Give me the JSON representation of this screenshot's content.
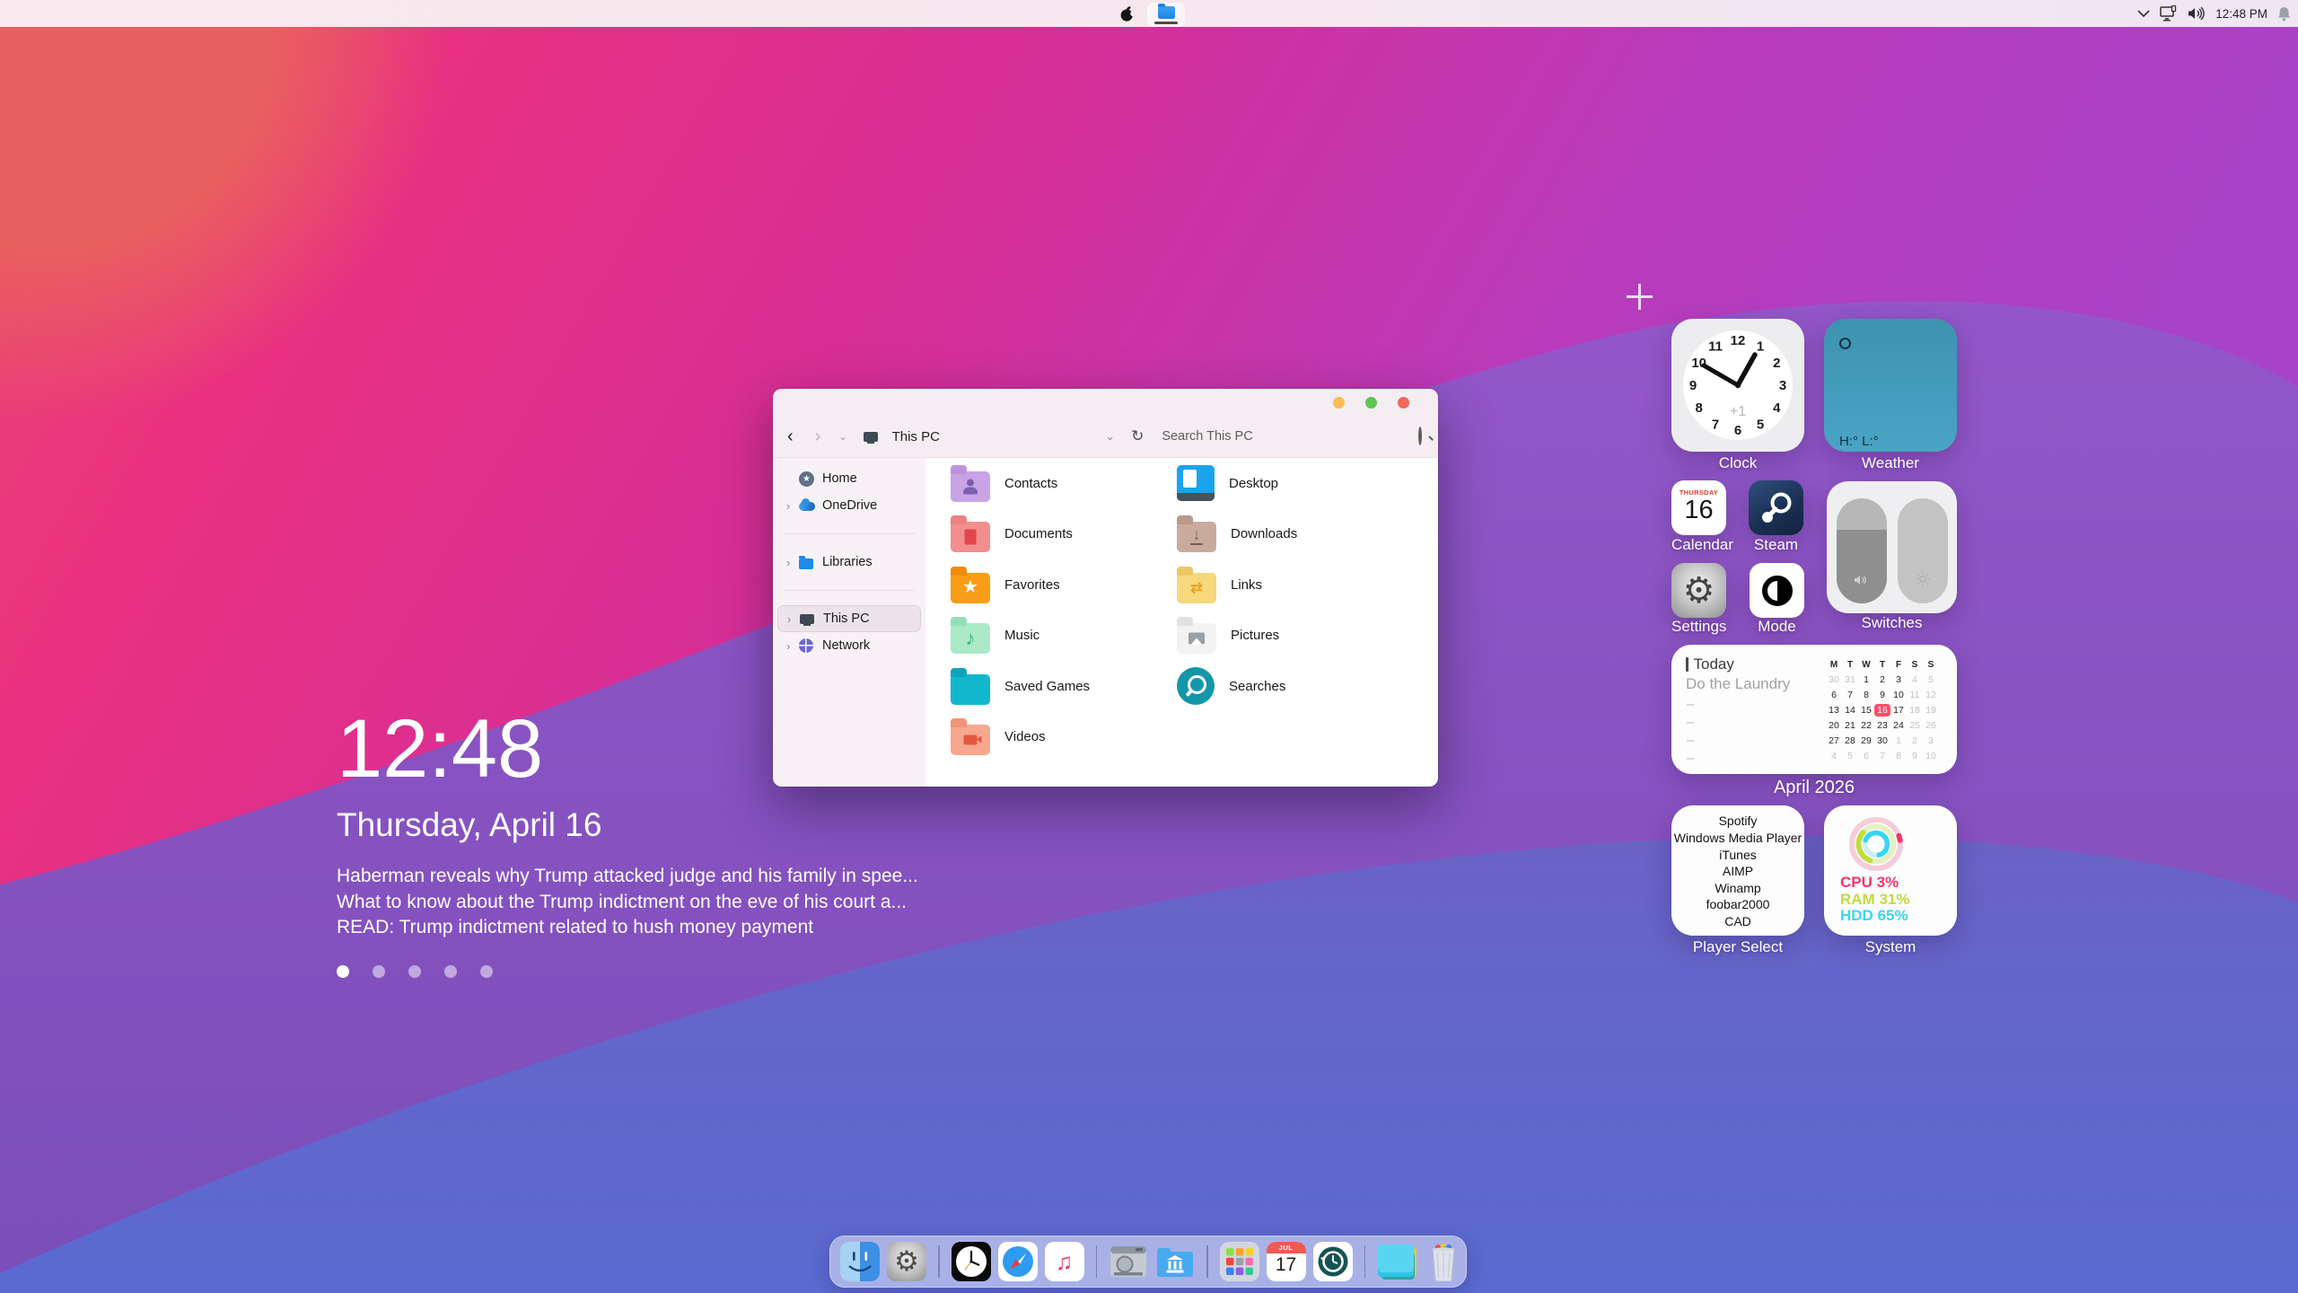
{
  "menu_bar": {
    "time": "12:48 PM",
    "taskbar_app": "file-explorer",
    "tray_icons": [
      "chevron-down-icon",
      "display-network-icon",
      "speaker-icon",
      "bell-icon"
    ]
  },
  "lockscreen": {
    "time": "12:48",
    "date": "Thursday, April 16",
    "headlines": [
      "Haberman reveals why Trump attacked judge and his family in spee...",
      "What to know about the Trump indictment on the eve of his court a...",
      "READ: Trump indictment related to hush money payment"
    ],
    "dots": 5
  },
  "window": {
    "title": "This PC",
    "search_placeholder": "Search This PC",
    "sidebar": [
      {
        "label": "Home",
        "icon": "home",
        "chevron": false
      },
      {
        "label": "OneDrive",
        "icon": "onedrive",
        "chevron": true,
        "divider_after": true
      },
      {
        "label": "Libraries",
        "icon": "libraries",
        "chevron": true,
        "divider_after": true
      },
      {
        "label": "This PC",
        "icon": "thispc",
        "chevron": true,
        "selected": true
      },
      {
        "label": "Network",
        "icon": "network",
        "chevron": true
      }
    ],
    "folders_col1": [
      {
        "name": "Contacts",
        "icon": "contacts",
        "body": "#c9a3e6",
        "tab": "#bd93dd"
      },
      {
        "name": "Documents",
        "icon": "documents",
        "body": "#f28e8e",
        "tab": "#ee8080"
      },
      {
        "name": "Favorites",
        "icon": "favorites",
        "body": "#f89d15",
        "tab": "#ef8b09"
      },
      {
        "name": "Music",
        "icon": "music",
        "body": "#abe9c7",
        "tab": "#94e0b6"
      },
      {
        "name": "Saved Games",
        "icon": "saved-games",
        "body": "#12b7ce",
        "tab": "#0da5bc"
      },
      {
        "name": "Videos",
        "icon": "videos",
        "body": "#f7a78e",
        "tab": "#f19379"
      }
    ],
    "folders_col2": [
      {
        "name": "Desktop",
        "icon": "desktop",
        "body": "#1ba3ec",
        "tab": "#1ba3ec"
      },
      {
        "name": "Downloads",
        "icon": "downloads",
        "body": "#c9ab9d",
        "tab": "#ba9a8b"
      },
      {
        "name": "Links",
        "icon": "links",
        "body": "#f6d87d",
        "tab": "#edc761"
      },
      {
        "name": "Pictures",
        "icon": "pictures",
        "body": "#f3f3f3",
        "tab": "#e2e2e2"
      },
      {
        "name": "Searches",
        "icon": "searches",
        "body": "#1397a8",
        "tab": "#1397a8"
      }
    ]
  },
  "widgets": {
    "clock": {
      "label": "Clock",
      "offset": "+1",
      "numbers": [
        1,
        2,
        3,
        4,
        5,
        6,
        7,
        8,
        9,
        10,
        11,
        12
      ]
    },
    "weather": {
      "label": "Weather",
      "hi_lo": "H:° L:°"
    },
    "calendar_small": {
      "label": "Calendar",
      "weekday": "THURSDAY",
      "day": "16"
    },
    "steam": {
      "label": "Steam"
    },
    "switches": {
      "label": "Switches"
    },
    "settings": {
      "label": "Settings"
    },
    "mode": {
      "label": "Mode"
    },
    "agenda": {
      "today_label": "Today",
      "event": "Do the Laundry",
      "placeholders": [
        "–",
        "–",
        "–",
        "–"
      ],
      "month_label": "April 2026",
      "day_headers": [
        "M",
        "T",
        "W",
        "T",
        "F",
        "S",
        "S"
      ],
      "weeks": [
        [
          "30*",
          "31*",
          "1",
          "2",
          "3",
          "4*",
          "5*"
        ],
        [
          "6",
          "7",
          "8",
          "9",
          "10",
          "11*",
          "12*"
        ],
        [
          "13",
          "14",
          "15",
          "!16",
          "17",
          "18*",
          "19*"
        ],
        [
          "20",
          "21",
          "22",
          "23",
          "24",
          "25*",
          "26*"
        ],
        [
          "27",
          "28",
          "29",
          "30",
          "1*",
          "2*",
          "3*"
        ],
        [
          "4*",
          "5*",
          "6*",
          "7*",
          "8*",
          "9*",
          "10*"
        ]
      ],
      "today_highlight": "#fb4d68"
    },
    "player_select": {
      "label": "Player Select",
      "items": [
        "Spotify",
        "Windows Media Player",
        "iTunes",
        "AIMP",
        "Winamp",
        "foobar2000",
        "CAD"
      ]
    },
    "system": {
      "label": "System",
      "cpu": "CPU 3%",
      "ram": "RAM 31%",
      "hdd": "HDD 65%",
      "cpu_pct": 3,
      "ram_pct": 31,
      "hdd_pct": 65,
      "cpu_color": "#f5356b",
      "ram_color": "#bfdd3a",
      "hdd_color": "#35d6f2"
    }
  },
  "dock": {
    "icons": [
      "finder",
      "system-settings",
      "divider",
      "clock-app",
      "safari",
      "music-app",
      "divider",
      "hard-drive",
      "library-folder",
      "divider",
      "launchpad",
      "calendar-app",
      "time-machine",
      "divider",
      "stickies",
      "trash"
    ],
    "calendar_month": "JUL",
    "calendar_day": "17",
    "running_app": "calendar-app"
  },
  "colors": {
    "traffic_yellow": "#f7bd50",
    "traffic_green": "#61c354",
    "traffic_red": "#ee6a5e",
    "wallpaper_pink": "#e93180",
    "wallpaper_violet": "#8a52c2",
    "wallpaper_blue": "#5c68c8"
  }
}
